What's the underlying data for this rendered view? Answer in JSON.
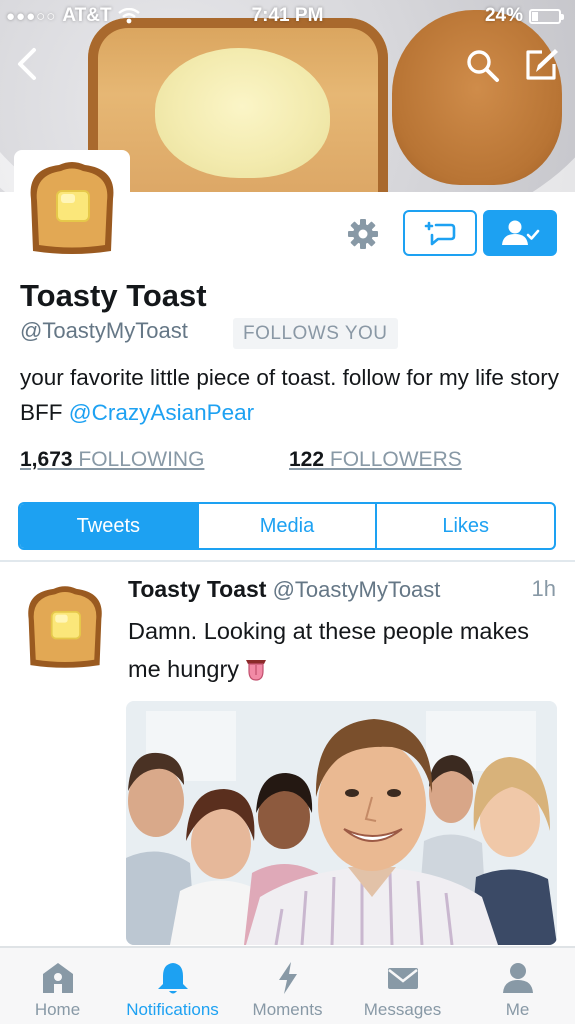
{
  "status_bar": {
    "signal": "●●●○○",
    "carrier": "AT&T",
    "time": "7:41 PM",
    "battery": "24%"
  },
  "header": {
    "icons": [
      "back-icon",
      "search-icon",
      "compose-icon"
    ]
  },
  "profile": {
    "display_name": "Toasty Toast",
    "handle": "@ToastyMyToast",
    "follows_you": "FOLLOWS YOU",
    "bio_text": "your favorite little piece of toast. follow for my life story BFF ",
    "bio_mention": "@CrazyAsianPear",
    "following_count": "1,673",
    "following_label": " FOLLOWING",
    "followers_count": "122",
    "followers_label": " FOLLOWERS",
    "action_icons": [
      "gear-icon",
      "retweet-icon",
      "following-user-icon"
    ]
  },
  "tabs": [
    {
      "label": "Tweets",
      "active": true
    },
    {
      "label": "Media",
      "active": false
    },
    {
      "label": "Likes",
      "active": false
    }
  ],
  "tweet": {
    "name": "Toasty Toast",
    "handle": "@ToastyMyToast",
    "time": "1h",
    "text": "Damn. Looking at these people makes me hungry",
    "emoji": "tongue-emoji",
    "media": "photo-group-of-smiling-people"
  },
  "tabbar": [
    {
      "label": "Home",
      "icon": "home-icon",
      "active": false
    },
    {
      "label": "Notifications",
      "icon": "bell-icon",
      "active": true
    },
    {
      "label": "Moments",
      "icon": "lightning-icon",
      "active": false
    },
    {
      "label": "Messages",
      "icon": "envelope-icon",
      "active": false
    },
    {
      "label": "Me",
      "icon": "person-icon",
      "active": false
    }
  ],
  "colors": {
    "accent": "#1da1f2",
    "text": "#14171a",
    "secondary": "#657786",
    "tab_inactive": "#8899a6"
  }
}
